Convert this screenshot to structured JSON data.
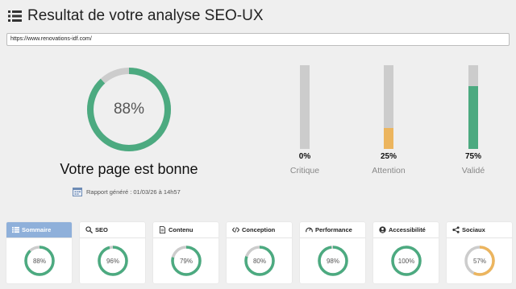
{
  "header": {
    "title": "Resultat de votre analyse SEO-UX"
  },
  "url": {
    "value": "https://www.renovations-idf.com/"
  },
  "summary": {
    "score_label": "88%",
    "score_fraction": 0.88,
    "verdict": "Votre page est bonne",
    "report_text": "Rapport généré : 01/03/26 à 14h57"
  },
  "levels": [
    {
      "pct": "0%",
      "label": "Critique",
      "fraction": 0.0,
      "color": "#5cb85c"
    },
    {
      "pct": "25%",
      "label": "Attention",
      "fraction": 0.25,
      "color": "#ecb55e"
    },
    {
      "pct": "75%",
      "label": "Validé",
      "fraction": 0.75,
      "color": "#4caa80"
    }
  ],
  "categories": [
    {
      "label": "Sommaire",
      "pct": "88%",
      "fraction": 0.88,
      "color": "#4caa80",
      "icon": "list-icon",
      "active": true
    },
    {
      "label": "SEO",
      "pct": "96%",
      "fraction": 0.96,
      "color": "#4caa80",
      "icon": "seo-search-icon"
    },
    {
      "label": "Contenu",
      "pct": "79%",
      "fraction": 0.79,
      "color": "#4caa80",
      "icon": "document-icon"
    },
    {
      "label": "Conception",
      "pct": "80%",
      "fraction": 0.8,
      "color": "#4caa80",
      "icon": "code-icon"
    },
    {
      "label": "Performance",
      "pct": "98%",
      "fraction": 0.98,
      "color": "#4caa80",
      "icon": "speedometer-icon"
    },
    {
      "label": "Accessibilité",
      "pct": "100%",
      "fraction": 1.0,
      "color": "#4caa80",
      "icon": "user-circle-icon"
    },
    {
      "label": "Sociaux",
      "pct": "57%",
      "fraction": 0.57,
      "color": "#ecb55e",
      "icon": "share-icon"
    }
  ],
  "colors": {
    "good": "#4caa80",
    "warn": "#ecb55e",
    "track": "#cccccc",
    "active_tab": "#8fb0da"
  }
}
